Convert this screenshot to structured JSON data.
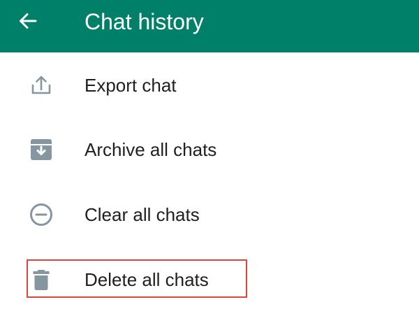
{
  "app_bar": {
    "title": "Chat history",
    "back_icon": "arrow-left-icon",
    "background_color": "#008069"
  },
  "menu": {
    "items": [
      {
        "label": "Export chat",
        "icon": "share-upload-icon"
      },
      {
        "label": "Archive all chats",
        "icon": "archive-box-icon"
      },
      {
        "label": "Clear all chats",
        "icon": "minus-circle-icon"
      },
      {
        "label": "Delete all chats",
        "icon": "trash-icon"
      }
    ],
    "icon_color": "#8696a0"
  },
  "highlight": {
    "target": "Delete all chats",
    "color": "#e0453a"
  }
}
